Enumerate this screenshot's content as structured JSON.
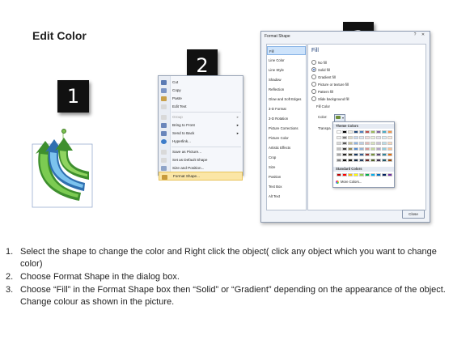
{
  "title": "Edit Color",
  "badges": {
    "one": "1",
    "two": "2",
    "three": "3"
  },
  "context_menu": {
    "items": [
      {
        "label": "Cut",
        "icon": "scissors-icon",
        "color": "#5b7bb4"
      },
      {
        "label": "Copy",
        "icon": "copy-icon",
        "color": "#7c95c6"
      },
      {
        "label": "Paste",
        "icon": "clipboard-icon",
        "color": "#c9a04a"
      },
      {
        "label": "Edit Text",
        "icon": "text-icon",
        "color": "#d9d9d9"
      },
      {
        "label": "Group",
        "icon": "group-icon",
        "color": "#d9d9d9",
        "disabled": true,
        "submenu": true
      },
      {
        "label": "Bring to Front",
        "icon": "bring-front-icon",
        "color": "#6a86bb",
        "submenu": true
      },
      {
        "label": "Send to Back",
        "icon": "send-back-icon",
        "color": "#6a86bb",
        "submenu": true
      },
      {
        "label": "Hyperlink...",
        "icon": "globe-icon",
        "color": "#3d7cc9"
      },
      {
        "label": "Save as Picture...",
        "icon": "picture-icon",
        "color": "#d9d9d9"
      },
      {
        "label": "Set as Default Shape",
        "icon": "shape-icon",
        "color": "#d9d9d9"
      },
      {
        "label": "Size and Position...",
        "icon": "size-icon",
        "color": "#8fa4c8"
      },
      {
        "label": "Format Shape...",
        "icon": "format-icon",
        "color": "#c89a3a",
        "highlighted": true
      }
    ]
  },
  "format_dialog": {
    "title": "Format Shape",
    "controls": {
      "help": "?",
      "close": "✕"
    },
    "nav": [
      "Fill",
      "Line Color",
      "Line Style",
      "Shadow",
      "Reflection",
      "Glow and Soft Edges",
      "3-D Format",
      "3-D Rotation",
      "Picture Corrections",
      "Picture Color",
      "Artistic Effects",
      "Crop",
      "Size",
      "Position",
      "Text Box",
      "Alt Text"
    ],
    "selected_nav": "Fill",
    "fill_heading": "Fill",
    "options": [
      "No fill",
      "Solid fill",
      "Gradient fill",
      "Picture or texture fill",
      "Pattern fill",
      "Slide background fill"
    ],
    "selected_option": "Solid fill",
    "fill_color_label": "Fill Color",
    "color_label": "Color:",
    "transparency_label": "Transpa",
    "close_button": "Close"
  },
  "palette": {
    "theme_header": "Theme Colors",
    "standard_header": "Standard Colors",
    "more_colors": "More Colors...",
    "theme_top": [
      "#ffffff",
      "#000000",
      "#eeece1",
      "#1f497d",
      "#4f81bd",
      "#c0504d",
      "#9bbb59",
      "#8064a2",
      "#4bacc6",
      "#f79646"
    ],
    "theme_shades": [
      [
        "#f2f2f2",
        "#7f7f7f",
        "#ddd9c3",
        "#c6d9f0",
        "#dbe5f1",
        "#f2dcdb",
        "#ebf1dd",
        "#e5e0ec",
        "#dbeef3",
        "#fdeada"
      ],
      [
        "#d8d8d8",
        "#595959",
        "#c4bd97",
        "#8db3e2",
        "#b8cce4",
        "#e5b9b7",
        "#d7e3bc",
        "#ccc1d9",
        "#b7dde8",
        "#fbd5b5"
      ],
      [
        "#bfbfbf",
        "#3f3f3f",
        "#938953",
        "#548dd4",
        "#95b3d7",
        "#d99694",
        "#c3d69b",
        "#b2a2c7",
        "#92cddc",
        "#fac08f"
      ],
      [
        "#a5a5a5",
        "#262626",
        "#494429",
        "#17365d",
        "#366092",
        "#953734",
        "#76923c",
        "#5f497a",
        "#31859b",
        "#e36c09"
      ],
      [
        "#7f7f7f",
        "#0c0c0c",
        "#1d1b10",
        "#0f243e",
        "#244061",
        "#632423",
        "#4f6128",
        "#3f3151",
        "#205867",
        "#974806"
      ]
    ],
    "standard": [
      "#c00000",
      "#ff0000",
      "#ffc000",
      "#ffff00",
      "#92d050",
      "#00b050",
      "#00b0f0",
      "#0070c0",
      "#002060",
      "#7030a0"
    ]
  },
  "steps": [
    {
      "num": "1.",
      "text": "Select the shape to change the color and Right click the object( click any object which you want to change color)"
    },
    {
      "num": "2.",
      "text": "Choose Format Shape in the dialog box."
    },
    {
      "num": "3.",
      "text": "Choose “Fill” in the Format Shape box then “Solid” or “Gradient” depending on the appearance of the object. Change colour as shown in the picture."
    }
  ]
}
